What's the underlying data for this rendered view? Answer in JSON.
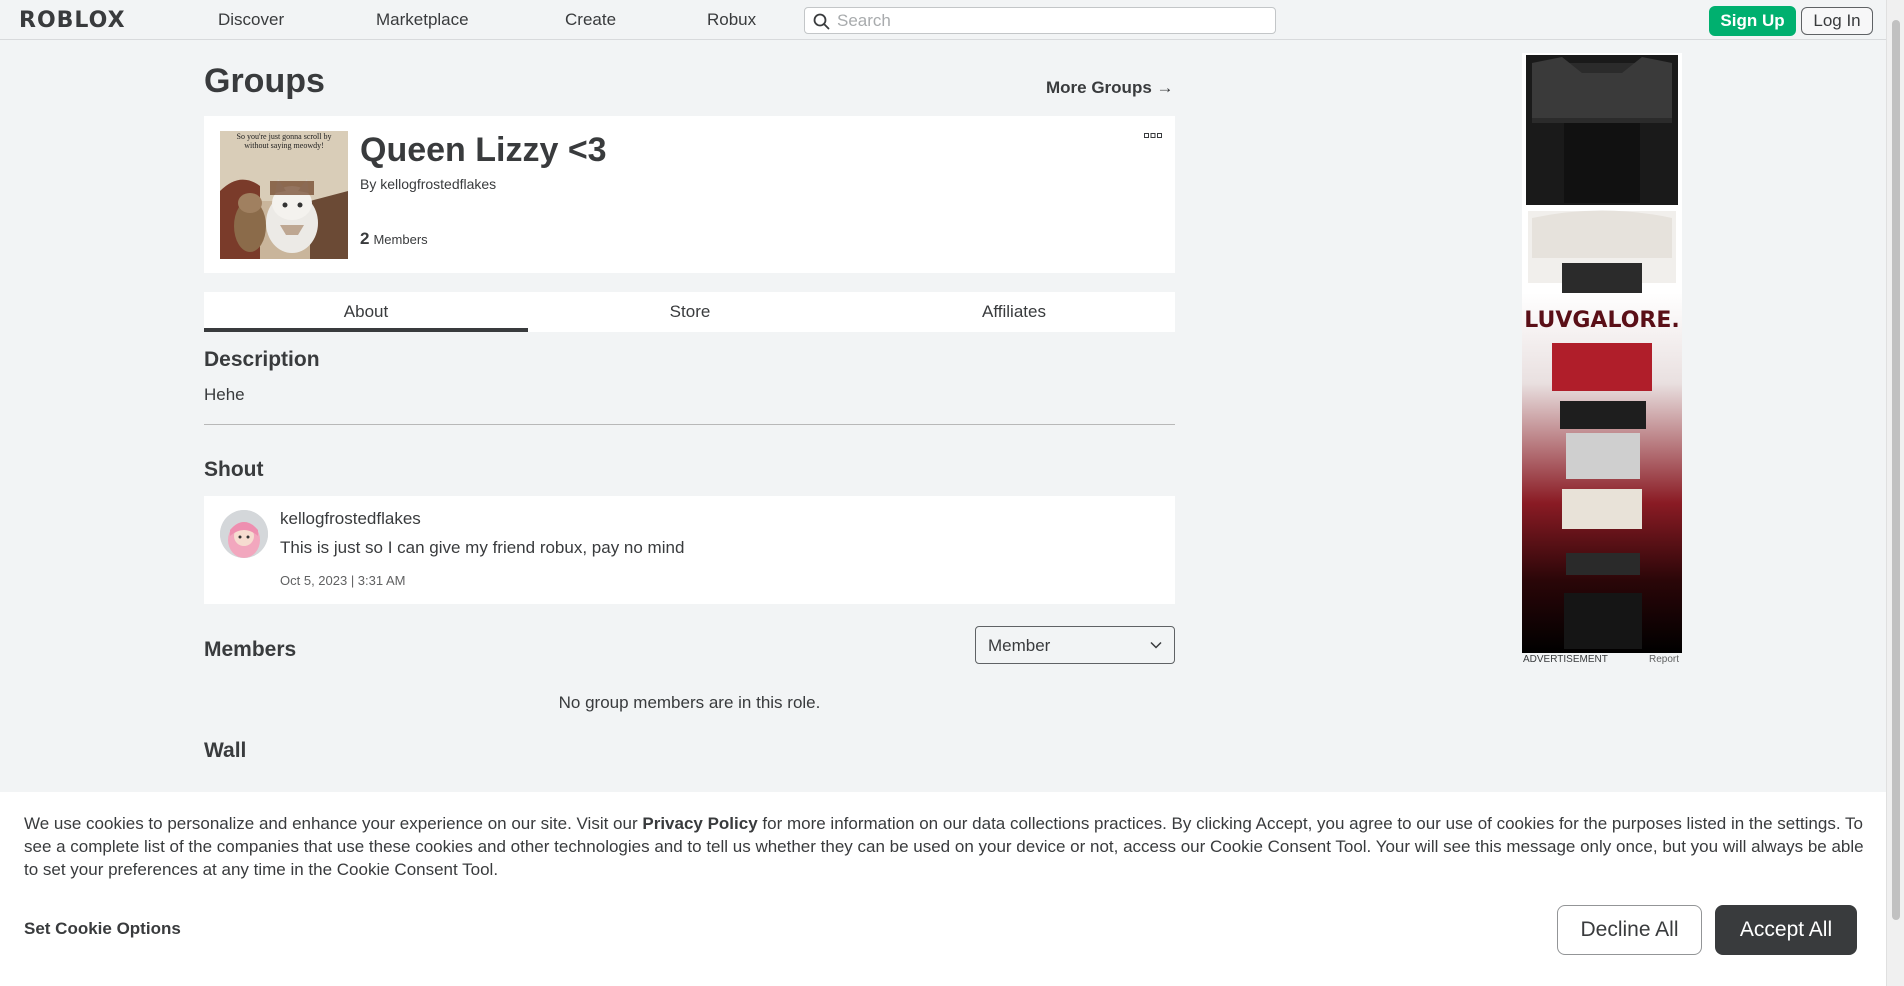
{
  "header": {
    "logo_text": "ROBLOX",
    "nav": [
      "Discover",
      "Marketplace",
      "Create",
      "Robux"
    ],
    "search_placeholder": "Search",
    "signup_label": "Sign Up",
    "login_label": "Log In"
  },
  "page": {
    "title": "Groups",
    "more_groups": "More Groups →"
  },
  "group": {
    "name": "Queen Lizzy <3",
    "by_label": "By",
    "owner": "kellogfrostedflakes",
    "member_count": "2",
    "member_label": "Members",
    "thumb_caption": "So you're just gonna scroll by without saying meowdy!"
  },
  "tabs": [
    "About",
    "Store",
    "Affiliates"
  ],
  "description": {
    "heading": "Description",
    "text": "Hehe"
  },
  "shout": {
    "heading": "Shout",
    "user": "kellogfrostedflakes",
    "body": "This is just so I can give my friend robux, pay no mind",
    "date": "Oct 5, 2023 | 3:31 AM"
  },
  "members": {
    "heading": "Members",
    "role_selected": "Member",
    "empty_text": "No group members are in this role."
  },
  "wall": {
    "heading": "Wall"
  },
  "ad": {
    "brand": "LUVGALORE.",
    "label": "ADVERTISEMENT",
    "report": "Report"
  },
  "cookie": {
    "text_before": "We use cookies to personalize and enhance your experience on our site. Visit our ",
    "privacy_link": "Privacy Policy",
    "text_after": " for more information on our data collections practices. By clicking Accept, you agree to our use of cookies for the purposes listed in the settings. To see a complete list of the companies that use these cookies and other technologies and to tell us whether they can be used on your device or not, access our Cookie Consent Tool. Your will see this message only once, but you will always be able to set your preferences at any time in the Cookie Consent Tool.",
    "options_label": "Set Cookie Options",
    "decline_label": "Decline All",
    "accept_label": "Accept All"
  },
  "colors": {
    "accent_green": "#00b06f",
    "text_primary": "#393b3d",
    "background": "#f2f4f5"
  }
}
